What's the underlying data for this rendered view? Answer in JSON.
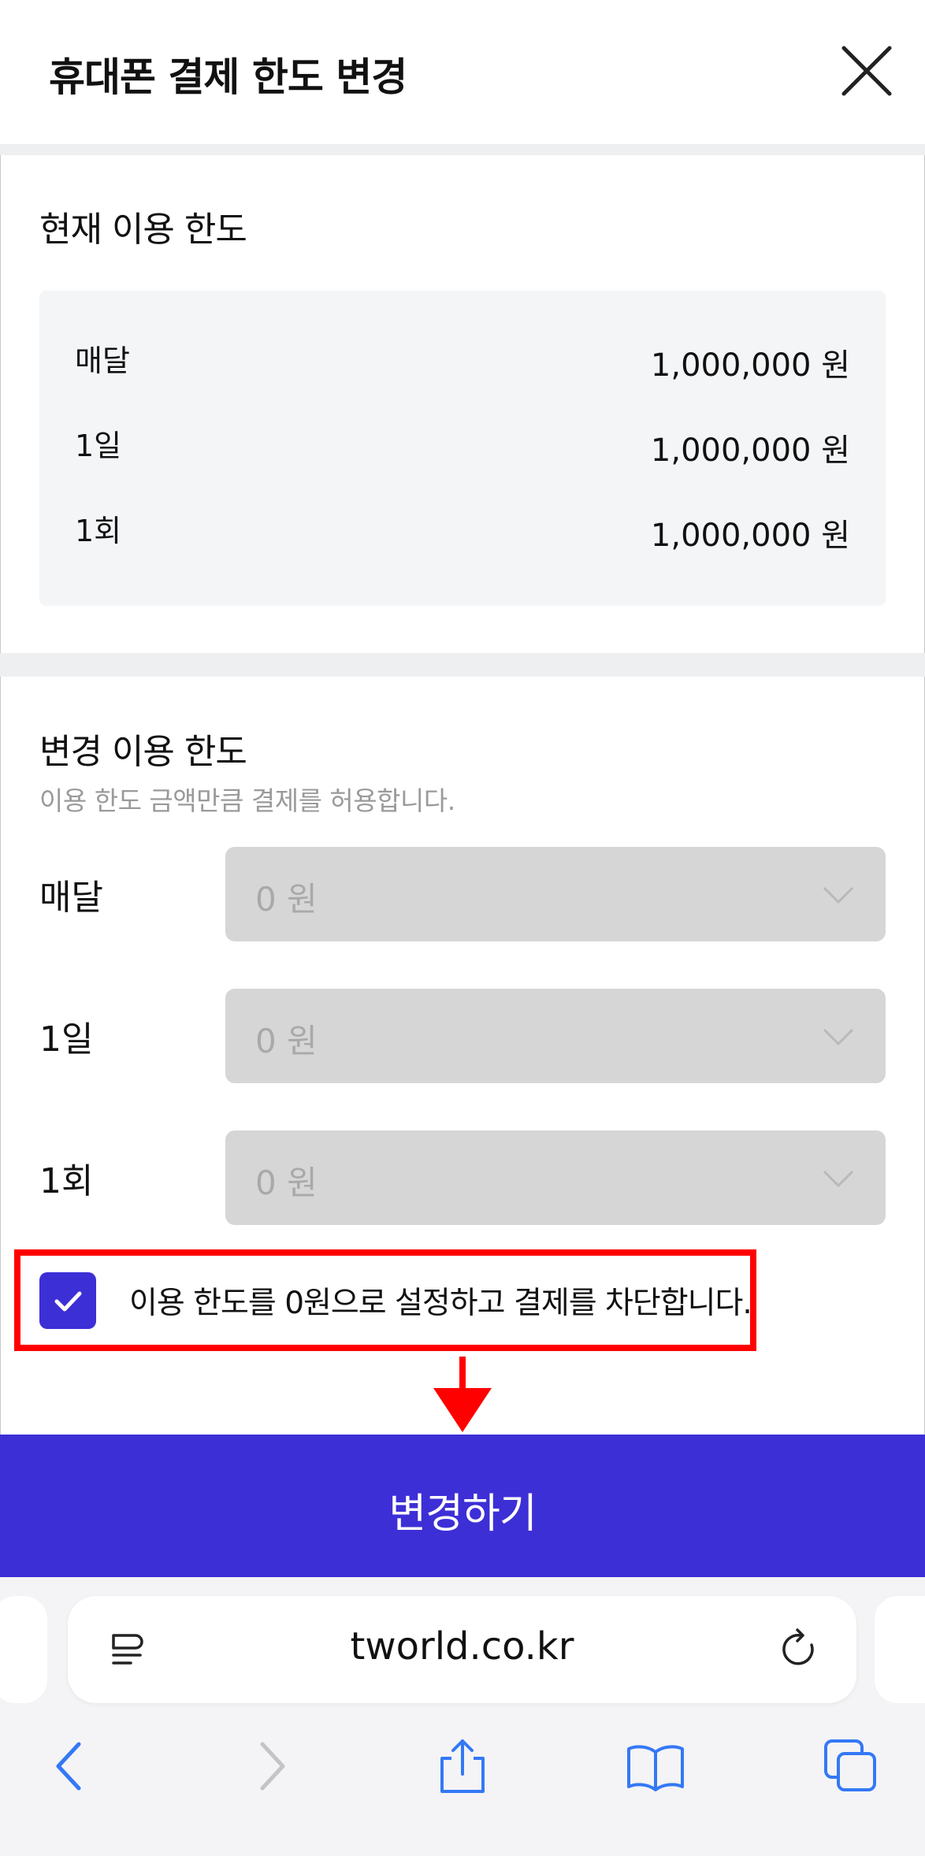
{
  "header": {
    "title": "휴대폰 결제 한도 변경",
    "close_icon": "close-icon"
  },
  "current": {
    "title": "현재 이용 한도",
    "rows": [
      {
        "label": "매달",
        "value": "1,000,000 원"
      },
      {
        "label": "1일",
        "value": "1,000,000 원"
      },
      {
        "label": "1회",
        "value": "1,000,000 원"
      }
    ]
  },
  "change": {
    "title": "변경 이용 한도",
    "subtitle": "이용 한도 금액만큼 결제를 허용합니다.",
    "fields": [
      {
        "label": "매달",
        "value": "0 원"
      },
      {
        "label": "1일",
        "value": "0 원"
      },
      {
        "label": "1회",
        "value": "0 원"
      }
    ],
    "block_label": "이용 한도를 0원으로 설정하고 결제를 차단합니다.",
    "block_checked": true
  },
  "submit": {
    "label": "변경하기"
  },
  "browser": {
    "url": "tworld.co.kr",
    "icons": [
      "reader-icon",
      "reload-icon",
      "back-icon",
      "forward-icon",
      "share-icon",
      "bookmarks-icon",
      "tabs-icon"
    ]
  },
  "colors": {
    "accent": "#3d2fd6",
    "highlight": "#ff0000",
    "disabled_field": "#d6d6d6"
  }
}
